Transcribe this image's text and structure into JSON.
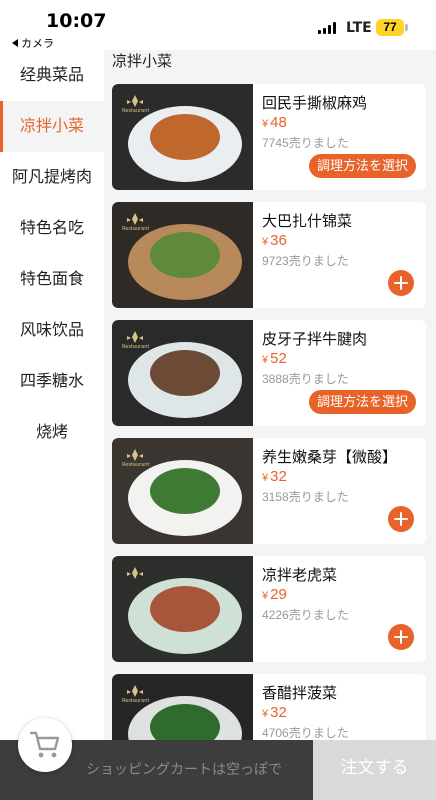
{
  "status_bar": {
    "time": "10:07",
    "back_label": "カメラ",
    "network": "LTE",
    "battery": "77"
  },
  "sidebar": {
    "items": [
      {
        "label": "经典菜品",
        "active": false
      },
      {
        "label": "凉拌小菜",
        "active": true
      },
      {
        "label": "阿凡提烤肉",
        "active": false
      },
      {
        "label": "特色名吃",
        "active": false
      },
      {
        "label": "特色面食",
        "active": false
      },
      {
        "label": "风味饮品",
        "active": false
      },
      {
        "label": "四季糖水",
        "active": false
      },
      {
        "label": "烧烤",
        "active": false
      }
    ]
  },
  "section": {
    "title": "凉拌小菜"
  },
  "dishes": [
    {
      "name": "回民手撕椒麻鸡",
      "currency": "¥",
      "price": "48",
      "sold": "7745売りました",
      "action": "options",
      "action_label": "調理方法を選択",
      "bg": "#2b2b2b",
      "plate": "#e9eef0",
      "food": "#c0672e",
      "logo_text": "Restaurant"
    },
    {
      "name": "大巴扎什锦菜",
      "currency": "¥",
      "price": "36",
      "sold": "9723売りました",
      "action": "add",
      "action_label": "",
      "bg": "#2f2a26",
      "plate": "#b8895a",
      "food": "#5e8a3a",
      "logo_text": "Restaurant"
    },
    {
      "name": "皮牙子拌牛腱肉",
      "currency": "¥",
      "price": "52",
      "sold": "3888売りました",
      "action": "options",
      "action_label": "調理方法を選択",
      "bg": "#2a2a2a",
      "plate": "#dfe6e8",
      "food": "#6b4a36",
      "logo_text": "Restaurant"
    },
    {
      "name": "养生嫩桑芽【微酸】",
      "currency": "¥",
      "price": "32",
      "sold": "3158売りました",
      "action": "add",
      "action_label": "",
      "bg": "#3a3530",
      "plate": "#f2f2f0",
      "food": "#3f7a35",
      "logo_text": "Restaurant"
    },
    {
      "name": "凉拌老虎菜",
      "currency": "¥",
      "price": "29",
      "sold": "4226売りました",
      "action": "add",
      "action_label": "",
      "bg": "#2c2e2c",
      "plate": "#cfe0d4",
      "food": "#a8563a",
      "logo_text": ""
    },
    {
      "name": "香醋拌菠菜",
      "currency": "¥",
      "price": "32",
      "sold": "4706売りました",
      "action": "add",
      "action_label": "",
      "bg": "#262626",
      "plate": "#dde2e0",
      "food": "#2f6b2c",
      "logo_text": "Restaurant"
    }
  ],
  "cart": {
    "empty_label": "ショッピングカートは空っぽで",
    "order_label": "注文する"
  },
  "colors": {
    "accent": "#e8632a",
    "cart_bar": "#3d3d3d",
    "order_disabled": "#d9d9d9"
  }
}
